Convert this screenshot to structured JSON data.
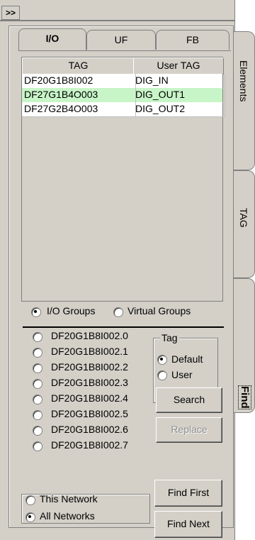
{
  "toolbar": {
    "expand_label": ">>"
  },
  "tabs": [
    {
      "label": "I/O",
      "active": true
    },
    {
      "label": "UF",
      "active": false
    },
    {
      "label": "FB",
      "active": false
    }
  ],
  "side_tabs": [
    {
      "label": "Elements"
    },
    {
      "label": "TAG"
    },
    {
      "label": "Find",
      "active": true
    }
  ],
  "tag_table": {
    "columns": [
      "TAG",
      "User TAG"
    ],
    "rows": [
      {
        "tag": "DF20G1B8I002",
        "user_tag": "DIG_IN",
        "highlighted": false
      },
      {
        "tag": "DF27G1B4O003",
        "user_tag": "DIG_OUT1",
        "highlighted": true
      },
      {
        "tag": "DF27G2B4O003",
        "user_tag": "DIG_OUT2",
        "highlighted": false
      }
    ],
    "highlight_color": "#c8f5c8"
  },
  "group_select": {
    "io_groups_label": "I/O Groups",
    "virtual_groups_label": "Virtual Groups",
    "selected": "io"
  },
  "channel_list": [
    "DF20G1B8I002.0",
    "DF20G1B8I002.1",
    "DF20G1B8I002.2",
    "DF20G1B8I002.3",
    "DF20G1B8I002.4",
    "DF20G1B8I002.5",
    "DF20G1B8I002.6",
    "DF20G1B8I002.7"
  ],
  "tag_options": {
    "title": "Tag",
    "default_label": "Default",
    "user_label": "User",
    "selected": "default"
  },
  "buttons": {
    "search": "Search",
    "replace": "Replace",
    "find_first": "Find First",
    "find_next": "Find Next"
  },
  "network_scope": {
    "this_network": "This Network",
    "all_networks": "All Networks",
    "selected": "all"
  }
}
